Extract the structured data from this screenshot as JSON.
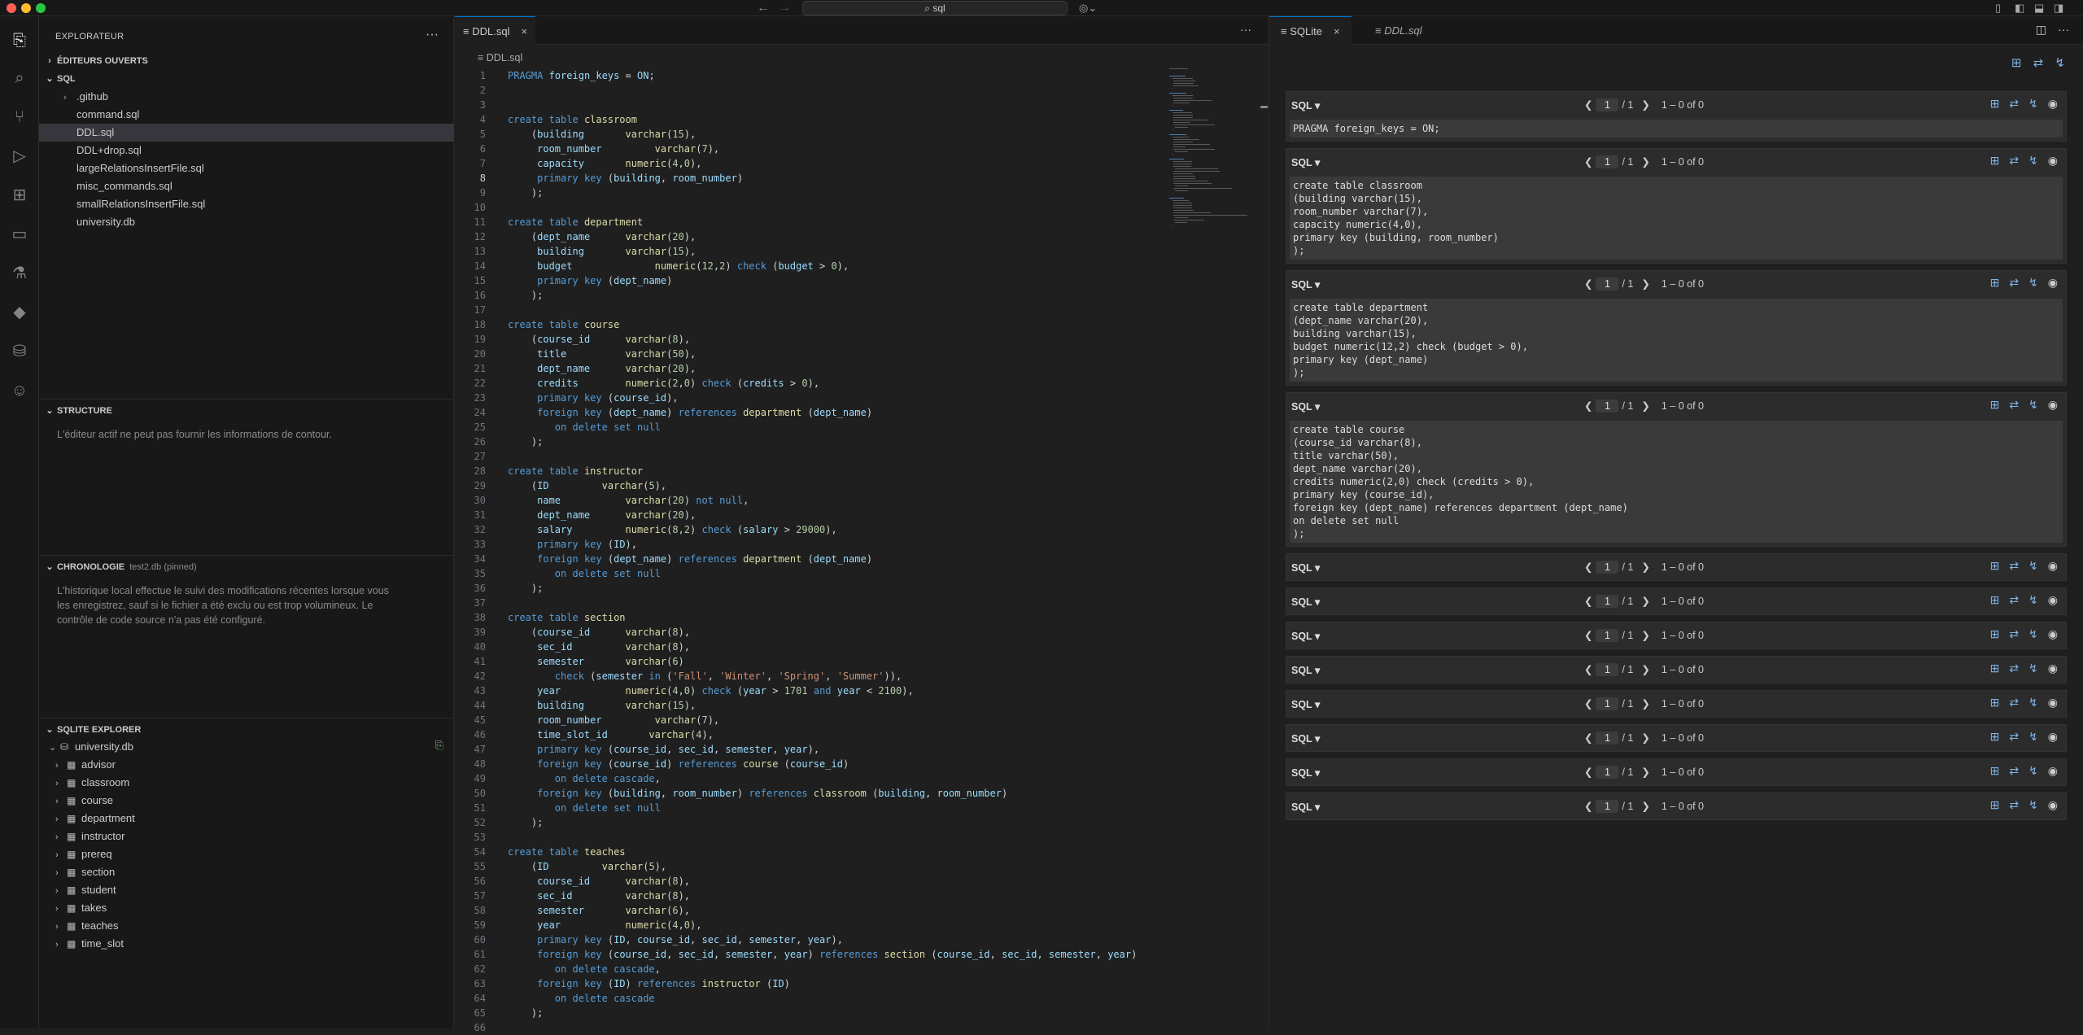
{
  "titlebar": {
    "search": "sql"
  },
  "sidebar": {
    "title": "EXPLORATEUR",
    "open_editors": "ÉDITEURS OUVERTS",
    "folder": "SQL",
    "files": [
      ".github",
      "command.sql",
      "DDL.sql",
      "DDL+drop.sql",
      "largeRelationsInsertFile.sql",
      "misc_commands.sql",
      "smallRelationsInsertFile.sql",
      "university.db"
    ],
    "structure": {
      "title": "STRUCTURE",
      "message": "L'éditeur actif ne peut pas fournir les informations de contour."
    },
    "timeline": {
      "title": "CHRONOLOGIE",
      "note": "test2.db (pinned)",
      "message1": "L'historique local effectue le suivi des modifications récentes lorsque vous",
      "message2": "les enregistrez, sauf si le fichier a été exclu ou est trop volumineux. Le",
      "message3": "contrôle de code source n'a pas été configuré."
    },
    "sqlite": {
      "title": "SQLITE EXPLORER",
      "db": "university.db",
      "tables": [
        "advisor",
        "classroom",
        "course",
        "department",
        "instructor",
        "prereq",
        "section",
        "student",
        "takes",
        "teaches",
        "time_slot"
      ]
    }
  },
  "editor": {
    "tab": "DDL.sql",
    "breadcrumb": "DDL.sql",
    "current_line": 8,
    "lines": [
      "PRAGMA foreign_keys = ON;",
      "",
      "",
      "create table classroom",
      "    (building       varchar(15),",
      "     room_number         varchar(7),",
      "     capacity       numeric(4,0),",
      "     primary key (building, room_number)",
      "    );",
      "",
      "create table department",
      "    (dept_name      varchar(20),",
      "     building       varchar(15),",
      "     budget              numeric(12,2) check (budget > 0),",
      "     primary key (dept_name)",
      "    );",
      "",
      "create table course",
      "    (course_id      varchar(8),",
      "     title          varchar(50),",
      "     dept_name      varchar(20),",
      "     credits        numeric(2,0) check (credits > 0),",
      "     primary key (course_id),",
      "     foreign key (dept_name) references department (dept_name)",
      "        on delete set null",
      "    );",
      "",
      "create table instructor",
      "    (ID         varchar(5),",
      "     name           varchar(20) not null,",
      "     dept_name      varchar(20),",
      "     salary         numeric(8,2) check (salary > 29000),",
      "     primary key (ID),",
      "     foreign key (dept_name) references department (dept_name)",
      "        on delete set null",
      "    );",
      "",
      "create table section",
      "    (course_id      varchar(8),",
      "     sec_id         varchar(8),",
      "     semester       varchar(6)",
      "        check (semester in ('Fall', 'Winter', 'Spring', 'Summer')),",
      "     year           numeric(4,0) check (year > 1701 and year < 2100),",
      "     building       varchar(15),",
      "     room_number         varchar(7),",
      "     time_slot_id       varchar(4),",
      "     primary key (course_id, sec_id, semester, year),",
      "     foreign key (course_id) references course (course_id)",
      "        on delete cascade,",
      "     foreign key (building, room_number) references classroom (building, room_number)",
      "        on delete set null",
      "    );",
      "",
      "create table teaches",
      "    (ID         varchar(5),",
      "     course_id      varchar(8),",
      "     sec_id         varchar(8),",
      "     semester       varchar(6),",
      "     year           numeric(4,0),",
      "     primary key (ID, course_id, sec_id, semester, year),",
      "     foreign key (course_id, sec_id, semester, year) references section (course_id, sec_id, semester, year)",
      "        on delete cascade,",
      "     foreign key (ID) references instructor (ID)",
      "        on delete cascade",
      "    );",
      ""
    ]
  },
  "rpanel": {
    "tab_active": "SQLite",
    "tab_other": "DDL.sql",
    "cells": [
      {
        "lang": "SQL ▾",
        "page": "1",
        "of": "/ 1",
        "rows": "1 – 0 of 0",
        "body": "PRAGMA foreign_keys = ON;"
      },
      {
        "lang": "SQL ▾",
        "page": "1",
        "of": "/ 1",
        "rows": "1 – 0 of 0",
        "body": "create table classroom\n(building varchar(15),\nroom_number varchar(7),\ncapacity numeric(4,0),\nprimary key (building, room_number)\n);"
      },
      {
        "lang": "SQL ▾",
        "page": "1",
        "of": "/ 1",
        "rows": "1 – 0 of 0",
        "body": "create table department\n(dept_name varchar(20),\nbuilding varchar(15),\nbudget numeric(12,2) check (budget > 0),\nprimary key (dept_name)\n);"
      },
      {
        "lang": "SQL ▾",
        "page": "1",
        "of": "/ 1",
        "rows": "1 – 0 of 0",
        "body": "create table course\n(course_id varchar(8),\ntitle varchar(50),\ndept_name varchar(20),\ncredits numeric(2,0) check (credits > 0),\nprimary key (course_id),\nforeign key (dept_name) references department (dept_name)\non delete set null\n);"
      },
      {
        "lang": "SQL ▾",
        "page": "1",
        "of": "/ 1",
        "rows": "1 – 0 of 0",
        "body": ""
      },
      {
        "lang": "SQL ▾",
        "page": "1",
        "of": "/ 1",
        "rows": "1 – 0 of 0",
        "body": ""
      },
      {
        "lang": "SQL ▾",
        "page": "1",
        "of": "/ 1",
        "rows": "1 – 0 of 0",
        "body": ""
      },
      {
        "lang": "SQL ▾",
        "page": "1",
        "of": "/ 1",
        "rows": "1 – 0 of 0",
        "body": ""
      },
      {
        "lang": "SQL ▾",
        "page": "1",
        "of": "/ 1",
        "rows": "1 – 0 of 0",
        "body": ""
      },
      {
        "lang": "SQL ▾",
        "page": "1",
        "of": "/ 1",
        "rows": "1 – 0 of 0",
        "body": ""
      },
      {
        "lang": "SQL ▾",
        "page": "1",
        "of": "/ 1",
        "rows": "1 – 0 of 0",
        "body": ""
      },
      {
        "lang": "SQL ▾",
        "page": "1",
        "of": "/ 1",
        "rows": "1 – 0 of 0",
        "body": ""
      }
    ]
  }
}
